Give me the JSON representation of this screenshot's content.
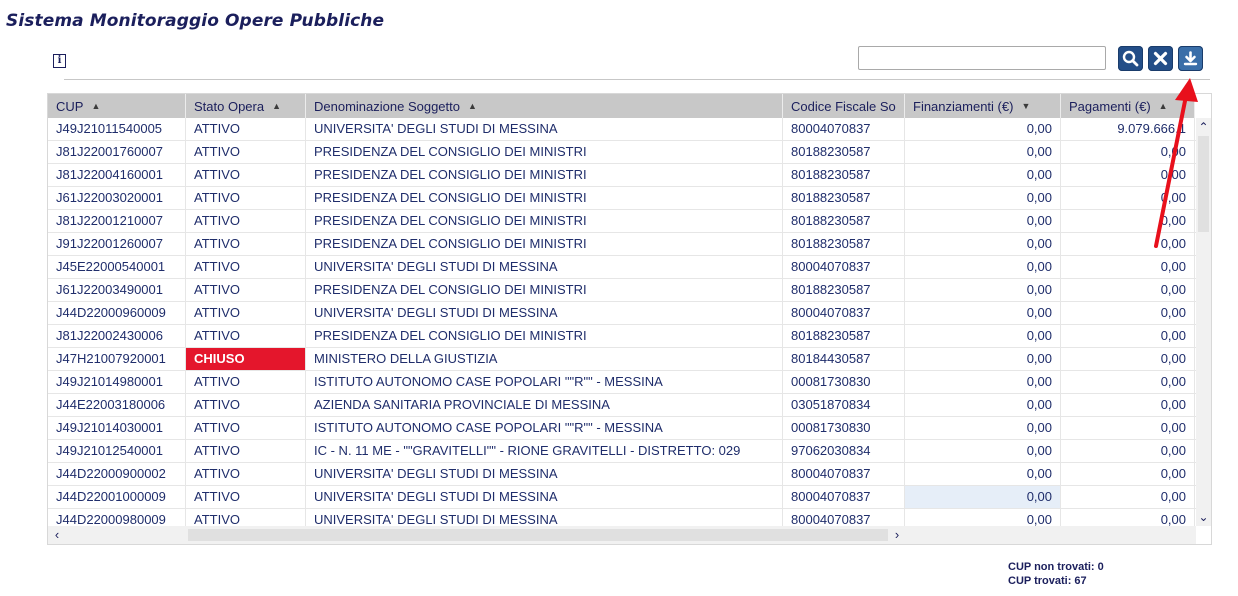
{
  "app": {
    "title": "Sistema Monitoraggio Opere Pubbliche"
  },
  "toolbar": {
    "search_value": "",
    "search_icon": "search-icon",
    "clear_icon": "close-icon",
    "download_icon": "download-icon",
    "info_glyph": "i"
  },
  "table": {
    "headers": [
      "CUP",
      "Stato Opera",
      "Denominazione Soggetto",
      "Codice Fiscale So",
      "Finanziamenti (€)",
      "Pagamenti (€)"
    ],
    "rows": [
      [
        "J49J21011540005",
        "ATTIVO",
        "UNIVERSITA' DEGLI STUDI DI MESSINA",
        "80004070837",
        "0,00",
        "9.079.666,1"
      ],
      [
        "J81J22001760007",
        "ATTIVO",
        "PRESIDENZA DEL CONSIGLIO DEI MINISTRI",
        "80188230587",
        "0,00",
        "0,00"
      ],
      [
        "J81J22004160001",
        "ATTIVO",
        "PRESIDENZA DEL CONSIGLIO DEI MINISTRI",
        "80188230587",
        "0,00",
        "0,00"
      ],
      [
        "J61J22003020001",
        "ATTIVO",
        "PRESIDENZA DEL CONSIGLIO DEI MINISTRI",
        "80188230587",
        "0,00",
        "0,00"
      ],
      [
        "J81J22001210007",
        "ATTIVO",
        "PRESIDENZA DEL CONSIGLIO DEI MINISTRI",
        "80188230587",
        "0,00",
        "0,00"
      ],
      [
        "J91J22001260007",
        "ATTIVO",
        "PRESIDENZA DEL CONSIGLIO DEI MINISTRI",
        "80188230587",
        "0,00",
        "0,00"
      ],
      [
        "J45E22000540001",
        "ATTIVO",
        "UNIVERSITA' DEGLI STUDI DI MESSINA",
        "80004070837",
        "0,00",
        "0,00"
      ],
      [
        "J61J22003490001",
        "ATTIVO",
        "PRESIDENZA DEL CONSIGLIO DEI MINISTRI",
        "80188230587",
        "0,00",
        "0,00"
      ],
      [
        "J44D22000960009",
        "ATTIVO",
        "UNIVERSITA' DEGLI STUDI DI MESSINA",
        "80004070837",
        "0,00",
        "0,00"
      ],
      [
        "J81J22002430006",
        "ATTIVO",
        "PRESIDENZA DEL CONSIGLIO DEI MINISTRI",
        "80188230587",
        "0,00",
        "0,00"
      ],
      [
        "J47H21007920001",
        "CHIUSO",
        "MINISTERO DELLA GIUSTIZIA",
        "80184430587",
        "0,00",
        "0,00"
      ],
      [
        "J49J21014980001",
        "ATTIVO",
        "ISTITUTO AUTONOMO CASE POPOLARI \"\"R\"\" - MESSINA",
        "00081730830",
        "0,00",
        "0,00"
      ],
      [
        "J44E22003180006",
        "ATTIVO",
        "AZIENDA SANITARIA PROVINCIALE DI MESSINA",
        "03051870834",
        "0,00",
        "0,00"
      ],
      [
        "J49J21014030001",
        "ATTIVO",
        "ISTITUTO AUTONOMO CASE POPOLARI \"\"R\"\" - MESSINA",
        "00081730830",
        "0,00",
        "0,00"
      ],
      [
        "J49J21012540001",
        "ATTIVO",
        "IC - N. 11 ME - \"\"GRAVITELLI\"\" - RIONE GRAVITELLI - DISTRETTO: 029",
        "97062030834",
        "0,00",
        "0,00"
      ],
      [
        "J44D22000900002",
        "ATTIVO",
        "UNIVERSITA' DEGLI STUDI DI MESSINA",
        "80004070837",
        "0,00",
        "0,00"
      ],
      [
        "J44D22001000009",
        "ATTIVO",
        "UNIVERSITA' DEGLI STUDI DI MESSINA",
        "80004070837",
        "0,00",
        "0,00"
      ],
      [
        "J44D22000980009",
        "ATTIVO",
        "UNIVERSITA' DEGLI STUDI DI MESSINA",
        "80004070837",
        "0,00",
        "0,00"
      ]
    ],
    "highlight_row": 16,
    "highlight_col": 4,
    "closed_color": "#e4162c"
  },
  "stats": {
    "not_found": "CUP non trovati: 0",
    "found": "CUP trovati: 67"
  },
  "annotation": {
    "arrow_color": "#e8101c"
  }
}
